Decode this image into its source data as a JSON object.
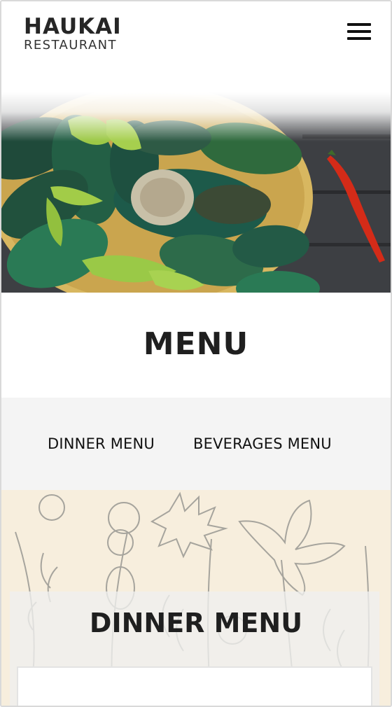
{
  "header": {
    "brand_name": "HAUKAI",
    "brand_sub": "RESTAURANT",
    "menu_icon": "hamburger-menu-icon"
  },
  "hero": {
    "image": "green mussels with basil and red chili on bamboo tray"
  },
  "page": {
    "title": "MENU"
  },
  "tabs": [
    {
      "label": "DINNER MENU"
    },
    {
      "label": "BEVERAGES MENU"
    }
  ],
  "section": {
    "title": "DINNER MENU"
  },
  "colors": {
    "tab_bar_bg": "#f4f4f4",
    "section_bg": "#f7eedd",
    "text": "#1f1f1f"
  }
}
